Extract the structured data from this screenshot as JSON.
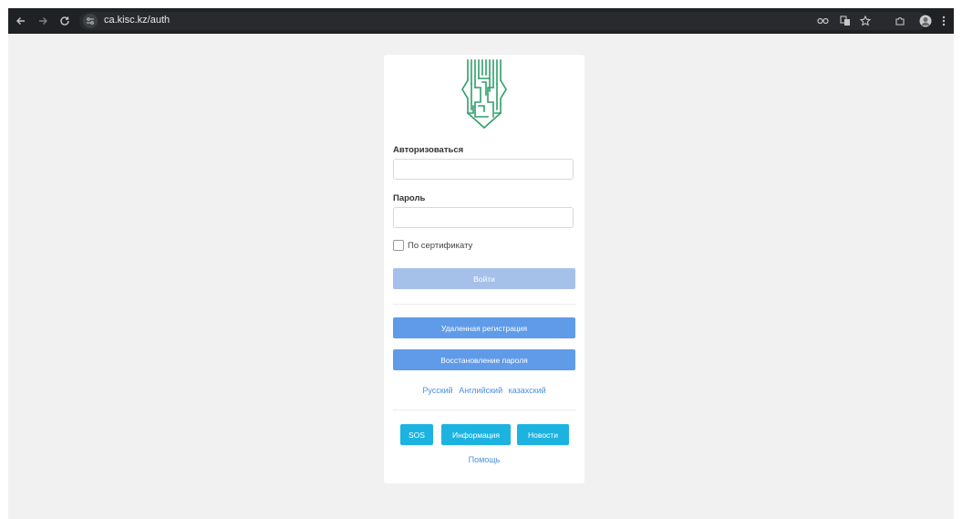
{
  "browser": {
    "url": "ca.kisc.kz/auth",
    "icons": [
      "back-icon",
      "forward-icon",
      "reload-icon",
      "site-info-icon",
      "password-key-icon",
      "translate-icon",
      "bookmark-star-icon",
      "extensions-icon",
      "profile-avatar-icon",
      "menu-kebab-icon"
    ]
  },
  "form": {
    "username_label": "Авторизоваться",
    "username_value": "",
    "password_label": "Пароль",
    "password_value": "",
    "certificate_label": "По сертификату",
    "login_button": "Войти",
    "remote_registration_button": "Удаленная регистрация",
    "password_recovery_button": "Восстановление пароля"
  },
  "languages": [
    "Русский",
    "Английский",
    "казахский"
  ],
  "footer": {
    "sos_button": "SOS",
    "info_button": "Информация",
    "news_button": "Новости",
    "help_link": "Помощь"
  },
  "colors": {
    "browser_bar": "#202124",
    "page_background": "#f1f1f1",
    "login_button_disabled": "#a5c1ea",
    "primary_button": "#5f9be8",
    "cyan_button": "#1db3e0",
    "link": "#4d8fe0",
    "logo_green": "#2e9e6a"
  }
}
